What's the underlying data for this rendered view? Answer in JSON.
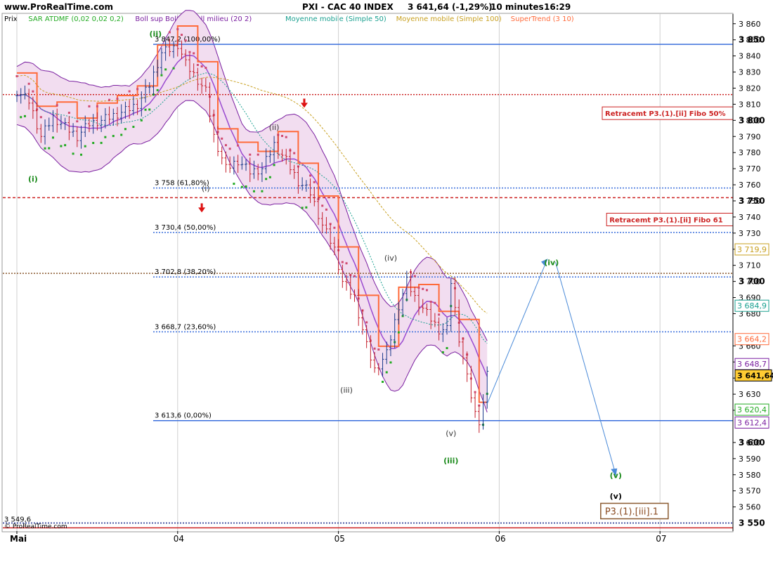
{
  "header": {
    "site": "www.ProRealTime.com",
    "title": "PXI - CAC 40 INDEX",
    "last": "3 641,64 (-1,29%)",
    "interval": "10 minutes",
    "time": "16:29",
    "copyright": "© ProRealTime.com"
  },
  "legend": [
    {
      "label": "Prix",
      "color": "#000000"
    },
    {
      "label": "SAR ATDMF (0,02 0,02 0,2)",
      "color": "#22aa22"
    },
    {
      "label": "Boll sup Boll inf Boll milieu (20 2)",
      "color": "#7a1fa0"
    },
    {
      "label": "Moyenne mobile (Simple 50)",
      "color": "#1aa090"
    },
    {
      "label": "Moyenne mobile (Simple 100)",
      "color": "#c8a020"
    },
    {
      "label": "SuperTrend (3 10)",
      "color": "#ff6a3a"
    }
  ],
  "chart_data": {
    "type": "line",
    "title": "PXI - CAC 40 INDEX",
    "ylim": [
      3545,
      3866
    ],
    "y_ticks": [
      3560,
      3570,
      3580,
      3590,
      3600,
      3620,
      3630,
      3640,
      3650,
      3660,
      3680,
      3690,
      3700,
      3710,
      3720,
      3730,
      3740,
      3750,
      3760,
      3770,
      3780,
      3790,
      3800,
      3810,
      3820,
      3830,
      3840,
      3850,
      3860
    ],
    "x_ticks": [
      {
        "label": "Mai",
        "i": 0
      },
      {
        "label": "04",
        "i": 40
      },
      {
        "label": "05",
        "i": 80
      },
      {
        "label": "06",
        "i": 120
      },
      {
        "label": "07",
        "i": 160
      }
    ],
    "bars_count": 118,
    "price": {
      "anchors": [
        [
          0,
          3818
        ],
        [
          3,
          3812
        ],
        [
          6,
          3790
        ],
        [
          9,
          3802
        ],
        [
          12,
          3796
        ],
        [
          15,
          3790
        ],
        [
          18,
          3798
        ],
        [
          21,
          3800
        ],
        [
          24,
          3803
        ],
        [
          27,
          3806
        ],
        [
          30,
          3810
        ],
        [
          33,
          3822
        ],
        [
          36,
          3842
        ],
        [
          39,
          3845
        ],
        [
          40,
          3847.2
        ],
        [
          42,
          3835
        ],
        [
          45,
          3825
        ],
        [
          47,
          3818
        ],
        [
          49,
          3790
        ],
        [
          52,
          3770
        ],
        [
          55,
          3775
        ],
        [
          58,
          3768
        ],
        [
          61,
          3770
        ],
        [
          64,
          3785
        ],
        [
          67,
          3775
        ],
        [
          70,
          3762
        ],
        [
          73,
          3755
        ],
        [
          76,
          3735
        ],
        [
          79,
          3720
        ],
        [
          81,
          3700
        ],
        [
          84,
          3690
        ],
        [
          87,
          3660
        ],
        [
          89,
          3645
        ],
        [
          92,
          3655
        ],
        [
          95,
          3685
        ],
        [
          97,
          3700
        ],
        [
          99,
          3690
        ],
        [
          102,
          3680
        ],
        [
          105,
          3670
        ],
        [
          107,
          3670
        ],
        [
          108,
          3700
        ],
        [
          110,
          3665
        ],
        [
          112,
          3640
        ],
        [
          114,
          3618
        ],
        [
          115,
          3613.6
        ],
        [
          116,
          3625
        ],
        [
          117,
          3641.64
        ]
      ]
    },
    "fib_levels": [
      {
        "value": 3847.2,
        "label": "3 847,2 (100,00%)",
        "color": "#3b6fdc",
        "style": "solid"
      },
      {
        "value": 3758,
        "label": "3 758 (61,80%)",
        "color": "#3b6fdc",
        "style": "dotted"
      },
      {
        "value": 3730.4,
        "label": "3 730,4 (50,00%)",
        "color": "#3b6fdc",
        "style": "dotted"
      },
      {
        "value": 3702.8,
        "label": "3 702,8 (38,20%)",
        "color": "#3b6fdc",
        "style": "dotted"
      },
      {
        "value": 3668.7,
        "label": "3 668,7 (23,60%)",
        "color": "#3b6fdc",
        "style": "dotted"
      },
      {
        "value": 3613.6,
        "label": "3 613,6 (0,00%)",
        "color": "#3b6fdc",
        "style": "solid"
      }
    ],
    "hlines": [
      {
        "value": 3816,
        "color": "#cc2222",
        "style": "dotted"
      },
      {
        "value": 3752,
        "color": "#cc2222",
        "style": "dashed"
      },
      {
        "value": 3705,
        "color": "#8a5a30",
        "style": "dotted"
      },
      {
        "value": 3550,
        "color": "#1a2a8a",
        "style": "dotted"
      },
      {
        "value": 3547,
        "color": "#cc2222",
        "style": "solid"
      }
    ],
    "level_boxes": [
      {
        "text": "Retracemt P3.(1).[ii] Fibo 50%",
        "value": 3804
      },
      {
        "text": "Retracemt P3.(1).[ii] Fibo 61",
        "value": 3738
      }
    ],
    "red_arrows": [
      {
        "i": 71.5,
        "value": 3810
      },
      {
        "i": 46,
        "value": 3745
      }
    ],
    "right_labels": [
      {
        "text": "3 719,9",
        "value": 3719.9,
        "color": "#c8a020"
      },
      {
        "text": "3 684,9",
        "value": 3684.9,
        "color": "#1aa090"
      },
      {
        "text": "3 664,2",
        "value": 3664.2,
        "color": "#ff6a3a"
      },
      {
        "text": "3 648,7",
        "value": 3648.7,
        "color": "#7a1fa0"
      },
      {
        "text": "3 641,64",
        "value": 3641.64,
        "color": "#000000",
        "filled": true
      },
      {
        "text": "3 620,4",
        "value": 3620.4,
        "color": "#22aa22"
      },
      {
        "text": "3 612,4",
        "value": 3612.4,
        "color": "#7a1fa0"
      }
    ],
    "bottom_label": {
      "text": "3 549,6",
      "value": 3549.6
    },
    "wave_labels": [
      {
        "text": "(ii)",
        "i": 34.5,
        "value": 3852,
        "color": "#1a8a1a",
        "bold": true
      },
      {
        "text": "(i)",
        "i": 4,
        "value": 3762,
        "color": "#1a8a1a",
        "bold": true
      },
      {
        "text": "(ii)",
        "i": 64,
        "value": 3794,
        "color": "#333333",
        "bold": false
      },
      {
        "text": "(i)",
        "i": 47,
        "value": 3756,
        "color": "#333333",
        "bold": false
      },
      {
        "text": "(iv)",
        "i": 93,
        "value": 3713,
        "color": "#333333",
        "bold": false
      },
      {
        "text": "(iii)",
        "i": 82,
        "value": 3631,
        "color": "#333333",
        "bold": false
      },
      {
        "text": "(v)",
        "i": 108,
        "value": 3604,
        "color": "#333333",
        "bold": false
      },
      {
        "text": "(iii)",
        "i": 108,
        "value": 3587,
        "color": "#1a8a1a",
        "bold": true
      },
      {
        "text": "(iv)",
        "i": 133,
        "value": 3710,
        "color": "#1a8a1a",
        "bold": true
      },
      {
        "text": "(v)",
        "i": 149,
        "value": 3578,
        "color": "#1a8a1a",
        "bold": true
      },
      {
        "text": "(v)",
        "i": 149,
        "value": 3565,
        "color": "#000000",
        "bold": true
      }
    ],
    "projection": [
      [
        117,
        3624
      ],
      [
        132,
        3714
      ],
      [
        134,
        3712
      ],
      [
        149,
        3580
      ]
    ],
    "target_box": {
      "text": "P3.(1).[iii].1",
      "i": 147,
      "value": 3557
    }
  }
}
